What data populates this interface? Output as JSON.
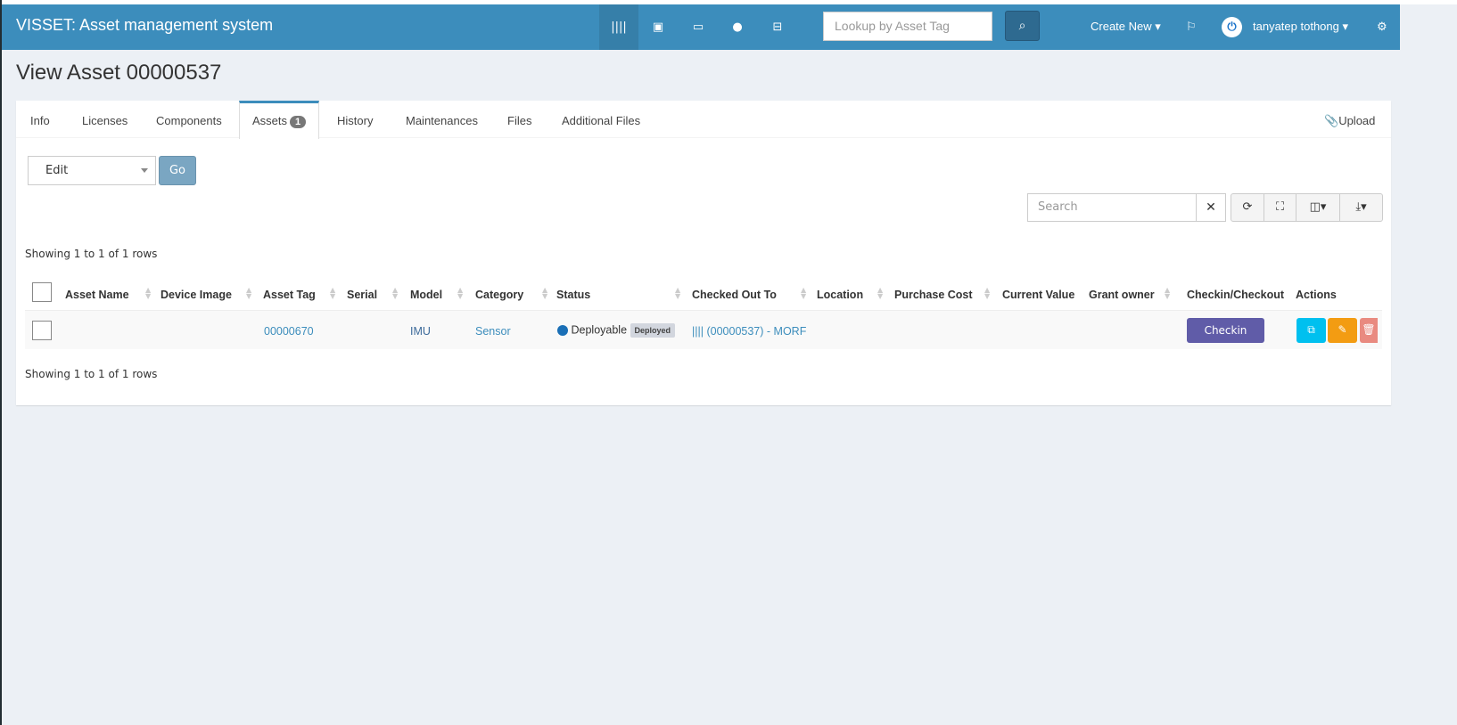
{
  "nav": {
    "brand": "VISSET: Asset management system",
    "lookup_placeholder": "Lookup by Asset Tag",
    "create_new": "Create New",
    "user": "tanyatep tothong"
  },
  "page": {
    "title": "View Asset 00000537"
  },
  "tabs": [
    {
      "label": "Info"
    },
    {
      "label": "Licenses"
    },
    {
      "label": "Components"
    },
    {
      "label": "Assets",
      "badge": "1"
    },
    {
      "label": "History"
    },
    {
      "label": "Maintenances"
    },
    {
      "label": "Files"
    },
    {
      "label": "Additional Files"
    }
  ],
  "upload": "Upload",
  "bulk": {
    "selected": "Edit",
    "go": "Go"
  },
  "search_placeholder": "Search",
  "showing": "Showing 1 to 1 of 1 rows",
  "columns": [
    "Asset Name",
    "Device Image",
    "Asset Tag",
    "Serial",
    "Model",
    "Category",
    "Status",
    "Checked Out To",
    "Location",
    "Purchase Cost",
    "Current Value",
    "Grant owner",
    "Checkin/Checkout",
    "Actions"
  ],
  "rows": [
    {
      "asset_tag": "00000670",
      "model": "IMU",
      "category": "Sensor",
      "status": "Deployable",
      "status_label": "Deployed",
      "checked_out_to": "(00000537) - MORF",
      "checkin": "Checkin"
    }
  ]
}
